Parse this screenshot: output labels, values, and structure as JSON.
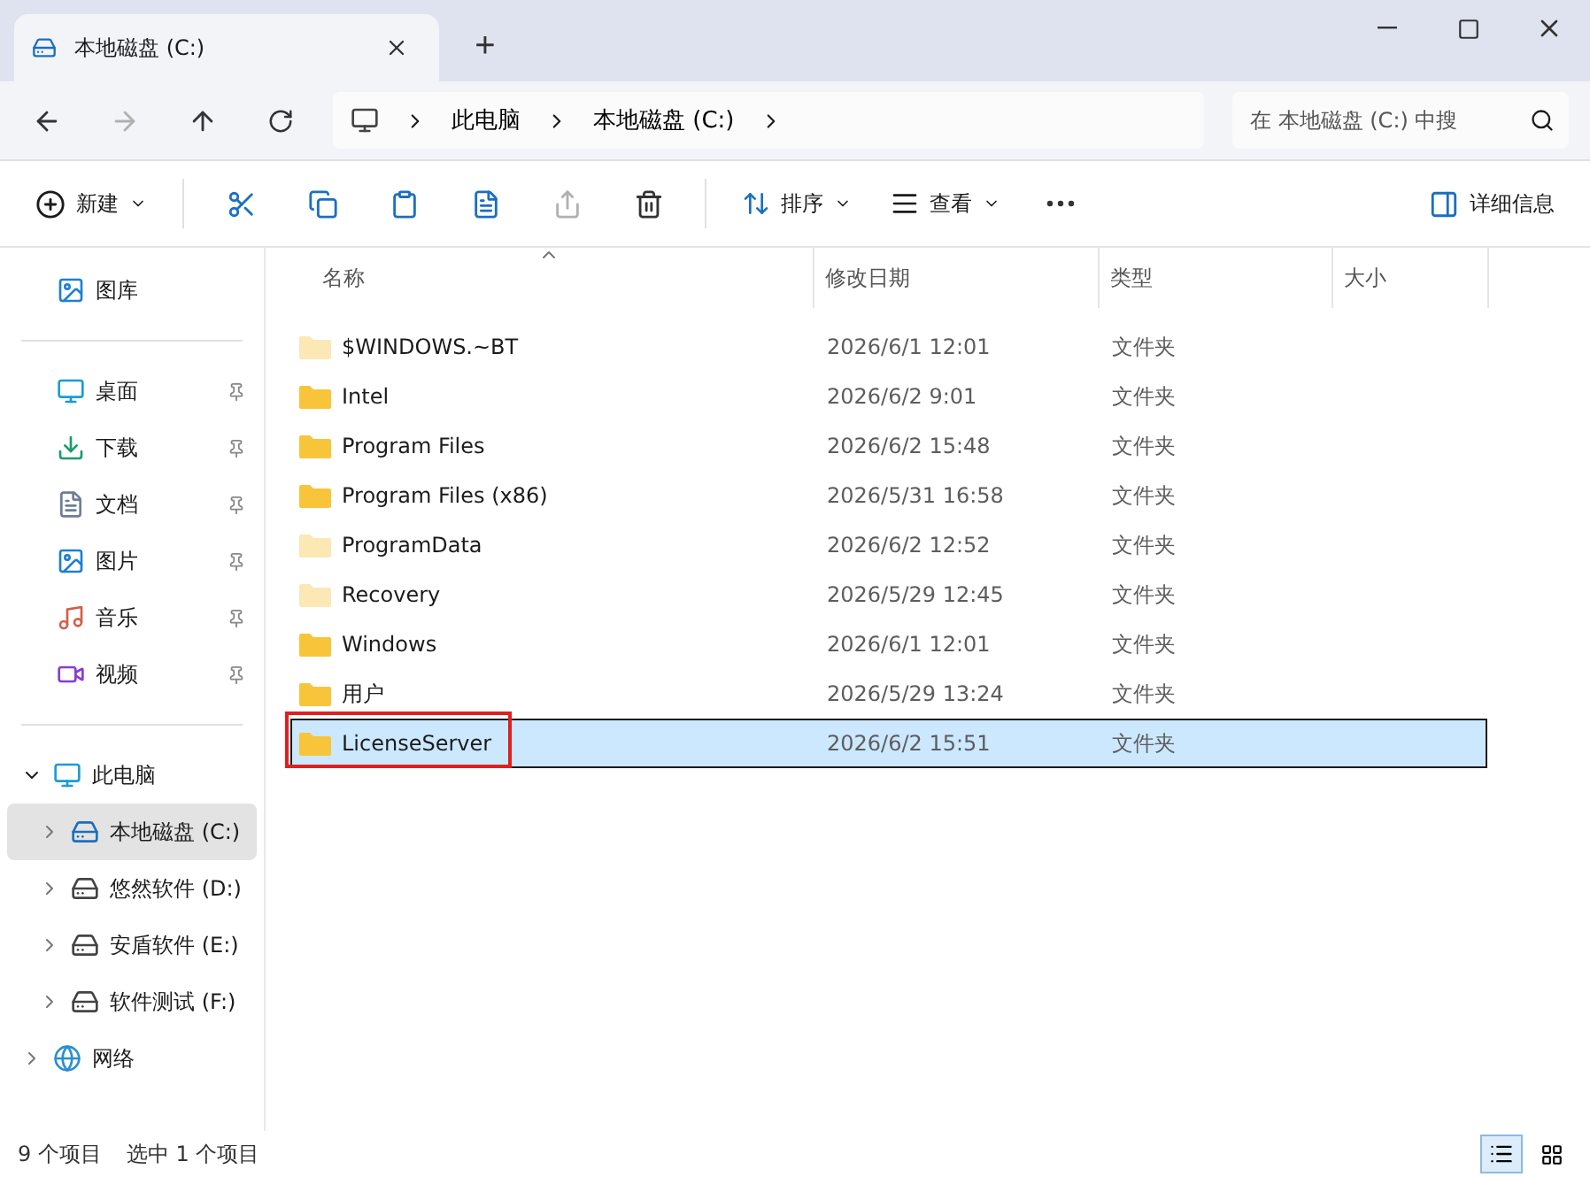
{
  "window": {
    "tab_title": "本地磁盘 (C:)",
    "new_tab": "+"
  },
  "address": {
    "crumbs": [
      "此电脑",
      "本地磁盘 (C:)"
    ],
    "search_placeholder": "在 本地磁盘 (C:) 中搜"
  },
  "toolbar": {
    "new_label": "新建",
    "sort_label": "排序",
    "view_label": "查看",
    "details_label": "详细信息"
  },
  "sidebar": {
    "top": [
      {
        "label": "图库",
        "kind": "gallery"
      }
    ],
    "pinned": [
      {
        "label": "桌面",
        "kind": "desktop"
      },
      {
        "label": "下载",
        "kind": "download"
      },
      {
        "label": "文档",
        "kind": "docs"
      },
      {
        "label": "图片",
        "kind": "pictures"
      },
      {
        "label": "音乐",
        "kind": "music"
      },
      {
        "label": "视频",
        "kind": "video"
      }
    ],
    "tree": [
      {
        "label": "此电脑",
        "kind": "pc",
        "expanded": true,
        "selected": false,
        "children": [
          {
            "label": "本地磁盘 (C:)",
            "kind": "sysdrive",
            "expanded": false,
            "selected": true
          },
          {
            "label": "悠然软件 (D:)",
            "kind": "drive",
            "expanded": false,
            "selected": false
          },
          {
            "label": "安盾软件 (E:)",
            "kind": "drive",
            "expanded": false,
            "selected": false
          },
          {
            "label": "软件测试 (F:)",
            "kind": "drive",
            "expanded": false,
            "selected": false
          }
        ]
      },
      {
        "label": "网络",
        "kind": "network",
        "expanded": false,
        "selected": false
      }
    ]
  },
  "table": {
    "columns": [
      "名称",
      "修改日期",
      "类型",
      "大小"
    ],
    "rows": [
      {
        "name": "$WINDOWS.~BT",
        "date": "2026/6/1 12:01",
        "type": "文件夹",
        "hidden": true,
        "selected": false,
        "annotated": false
      },
      {
        "name": "Intel",
        "date": "2026/6/2 9:01",
        "type": "文件夹",
        "hidden": false,
        "selected": false,
        "annotated": false
      },
      {
        "name": "Program Files",
        "date": "2026/6/2 15:48",
        "type": "文件夹",
        "hidden": false,
        "selected": false,
        "annotated": false
      },
      {
        "name": "Program Files (x86)",
        "date": "2026/5/31 16:58",
        "type": "文件夹",
        "hidden": false,
        "selected": false,
        "annotated": false
      },
      {
        "name": "ProgramData",
        "date": "2026/6/2 12:52",
        "type": "文件夹",
        "hidden": true,
        "selected": false,
        "annotated": false
      },
      {
        "name": "Recovery",
        "date": "2026/5/29 12:45",
        "type": "文件夹",
        "hidden": true,
        "selected": false,
        "annotated": false
      },
      {
        "name": "Windows",
        "date": "2026/6/1 12:01",
        "type": "文件夹",
        "hidden": false,
        "selected": false,
        "annotated": false
      },
      {
        "name": "用户",
        "date": "2026/5/29 13:24",
        "type": "文件夹",
        "hidden": false,
        "selected": false,
        "annotated": false
      },
      {
        "name": "LicenseServer",
        "date": "2026/6/2 15:51",
        "type": "文件夹",
        "hidden": false,
        "selected": true,
        "annotated": true
      }
    ]
  },
  "status_bar": {
    "count": "9 个项目",
    "selection": "选中 1 个项目",
    "views": [
      {
        "kind": "details",
        "selected": true
      },
      {
        "kind": "tiles",
        "selected": false
      }
    ]
  }
}
